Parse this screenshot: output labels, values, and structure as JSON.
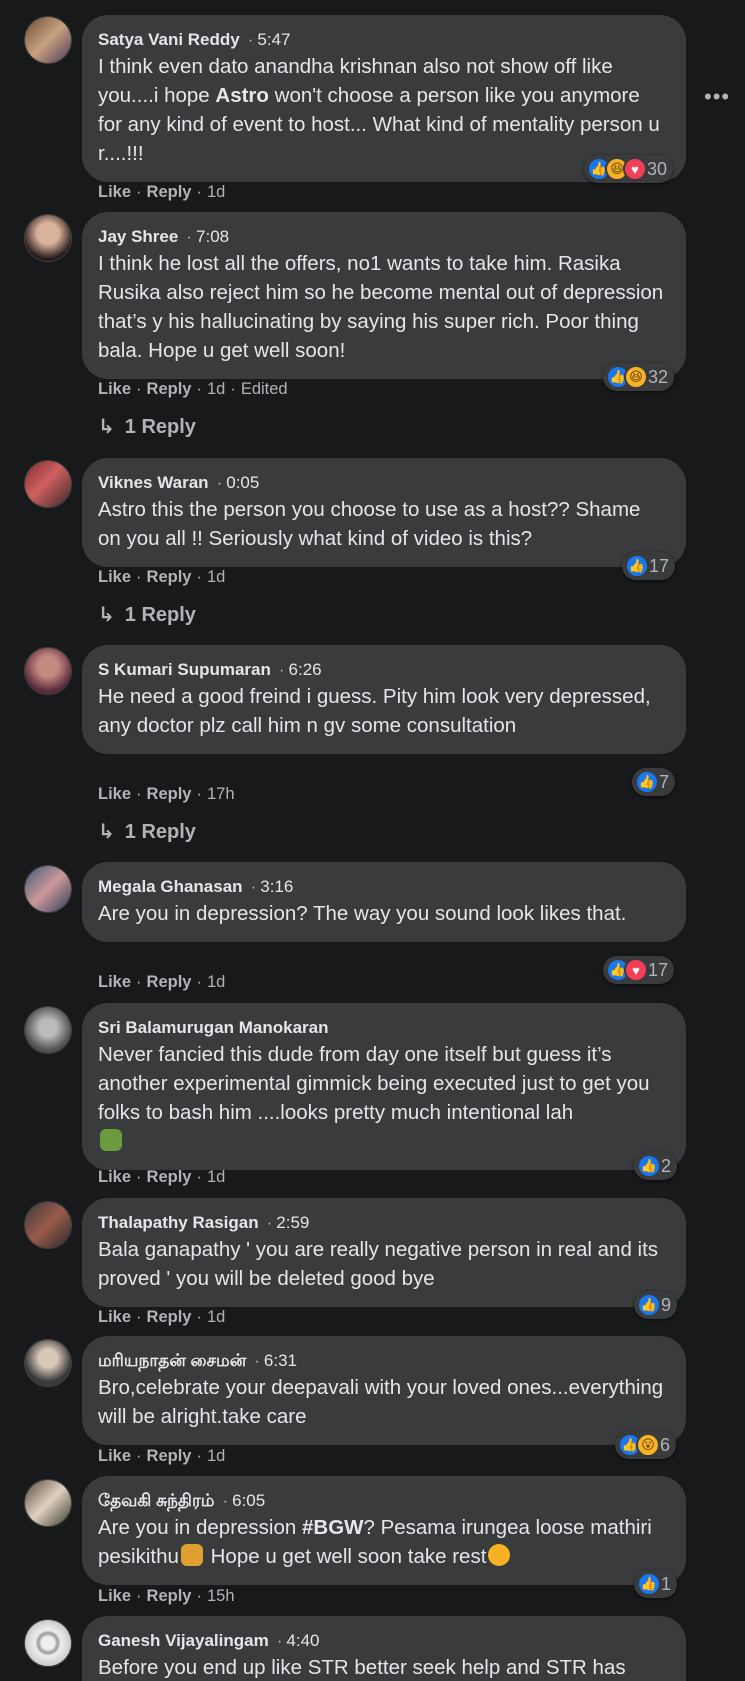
{
  "more_label": "•••",
  "comments": [
    {
      "name": "Satya Vani Reddy",
      "time": "5:47",
      "text_parts": [
        "I think even dato anandha krishnan also not show off like you....i hope ",
        "Astro",
        " won't choose a person like you anymore for any kind of event to host... What kind of mentality person u r....!!!"
      ],
      "actions": {
        "like": "Like",
        "reply": "Reply",
        "age": "1d",
        "edited": ""
      },
      "reactions": {
        "icons": [
          "like",
          "haha",
          "love"
        ],
        "count": "30"
      },
      "replies": ""
    },
    {
      "name": "Jay Shree",
      "time": "7:08",
      "text": "I think he lost all the offers, no1 wants to take him. Rasika Rusika also reject him so he become mental out of depression that’s y his hallucinating by saying his super rich. Poor thing bala. Hope u get well soon!",
      "actions": {
        "like": "Like",
        "reply": "Reply",
        "age": "1d",
        "edited": "Edited"
      },
      "reactions": {
        "icons": [
          "like",
          "haha"
        ],
        "count": "32"
      },
      "replies": "1 Reply"
    },
    {
      "name": "Viknes Waran",
      "time": "0:05",
      "text": "Astro this the person you choose to use as a host?? Shame on you all !! Seriously what kind of video is this?",
      "actions": {
        "like": "Like",
        "reply": "Reply",
        "age": "1d",
        "edited": ""
      },
      "reactions": {
        "icons": [
          "like"
        ],
        "count": "17"
      },
      "replies": "1 Reply"
    },
    {
      "name": "S Kumari Supumaran",
      "time": "6:26",
      "text": "He need a good freind i guess. Pity him look very depressed, any doctor plz call him n gv some consultation",
      "actions": {
        "like": "Like",
        "reply": "Reply",
        "age": "17h",
        "edited": ""
      },
      "reactions": {
        "icons": [
          "like"
        ],
        "count": "7"
      },
      "replies": "1 Reply"
    },
    {
      "name": "Megala Ghanasan",
      "time": "3:16",
      "text": "Are you in depression? The way you sound look likes that.",
      "actions": {
        "like": "Like",
        "reply": "Reply",
        "age": "1d",
        "edited": ""
      },
      "reactions": {
        "icons": [
          "like",
          "love"
        ],
        "count": "17"
      },
      "replies": ""
    },
    {
      "name": "Sri Balamurugan Manokaran",
      "time": "",
      "text": "Never fancied this dude from day one itself but guess it’s another experimental gimmick being executed just to get you folks to bash him ....looks pretty much intentional lah",
      "actions": {
        "like": "Like",
        "reply": "Reply",
        "age": "1d",
        "edited": ""
      },
      "reactions": {
        "icons": [
          "like"
        ],
        "count": "2"
      },
      "replies": ""
    },
    {
      "name": "Thalapathy Rasigan",
      "time": "2:59",
      "text": "Bala ganapathy ' you are really negative person in real and its proved ' you will be deleted good bye",
      "actions": {
        "like": "Like",
        "reply": "Reply",
        "age": "1d",
        "edited": ""
      },
      "reactions": {
        "icons": [
          "like"
        ],
        "count": "9"
      },
      "replies": ""
    },
    {
      "name": "மரியநாதன் சைமன்",
      "time": "6:31",
      "text": "Bro,celebrate your deepavali with your loved ones...everything will be alright.take care",
      "actions": {
        "like": "Like",
        "reply": "Reply",
        "age": "1d",
        "edited": ""
      },
      "reactions": {
        "icons": [
          "like",
          "wow"
        ],
        "count": "6"
      },
      "replies": ""
    },
    {
      "name": "தேவகி சுந்திரம்",
      "time": "6:05",
      "text_parts": [
        "Are you in depression ",
        "#BGW",
        "? Pesama irungea loose mathiri pesikithu",
        " Hope u get well soon take rest"
      ],
      "actions": {
        "like": "Like",
        "reply": "Reply",
        "age": "15h",
        "edited": ""
      },
      "reactions": {
        "icons": [
          "like"
        ],
        "count": "1"
      },
      "replies": ""
    },
    {
      "name": "Ganesh Vijayalingam",
      "time": "4:40",
      "text": "Before you end up like STR better seek help and STR has",
      "actions": {
        "like": "",
        "reply": "",
        "age": "",
        "edited": ""
      },
      "reactions": {
        "icons": [],
        "count": ""
      },
      "replies": ""
    }
  ],
  "colors": {
    "bg": "#18191a",
    "bubble": "#3a3b3c",
    "text": "#e4e6eb",
    "muted": "#b0b3b8",
    "like": "#1877f2",
    "love": "#f33e58",
    "haha": "#f7b125"
  }
}
